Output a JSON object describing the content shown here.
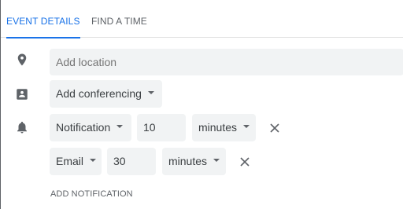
{
  "tabs": [
    {
      "label": "EVENT DETAILS",
      "active": true
    },
    {
      "label": "FIND A TIME",
      "active": false
    }
  ],
  "location": {
    "placeholder": "Add location"
  },
  "conferencing": {
    "label": "Add conferencing"
  },
  "notifications": [
    {
      "type": "Notification",
      "value": "10",
      "unit": "minutes"
    },
    {
      "type": "Email",
      "value": "30",
      "unit": "minutes"
    }
  ],
  "add_notification_label": "ADD NOTIFICATION",
  "colors": {
    "accent": "#1a73e8",
    "field_bg": "#f1f3f4",
    "icon": "#5f6368"
  }
}
